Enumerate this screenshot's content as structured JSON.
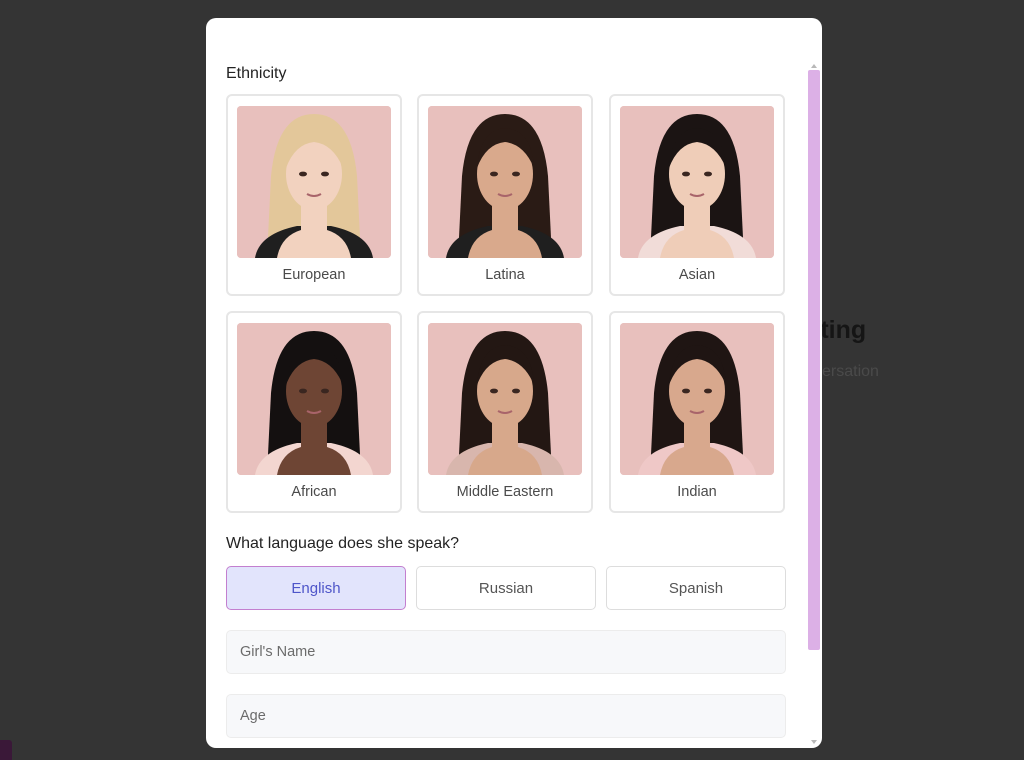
{
  "background": {
    "heading_fragment": "tting",
    "subtitle_fragment": "versation"
  },
  "modal": {
    "ethnicity_label": "Ethnicity",
    "ethnicities": [
      {
        "label": "European",
        "hair": "#e3c79a",
        "skin": "#f2d2bf",
        "top": "#1f1f1f"
      },
      {
        "label": "Latina",
        "hair": "#2a1b15",
        "skin": "#d9a98c",
        "top": "#1f1f1f"
      },
      {
        "label": "Asian",
        "hair": "#1b1413",
        "skin": "#efcdb8",
        "top": "#f1dcd8"
      },
      {
        "label": "African",
        "hair": "#141010",
        "skin": "#6e4534",
        "top": "#f3d6d0"
      },
      {
        "label": "Middle Eastern",
        "hair": "#231713",
        "skin": "#d7a88b",
        "top": "#d8b6ad"
      },
      {
        "label": "Indian",
        "hair": "#1f1513",
        "skin": "#d8a88d",
        "top": "#efc8c7"
      }
    ],
    "language_label": "What language does she speak?",
    "languages": [
      {
        "label": "English",
        "selected": true
      },
      {
        "label": "Russian",
        "selected": false
      },
      {
        "label": "Spanish",
        "selected": false
      }
    ],
    "name_field": {
      "placeholder": "Girl's Name",
      "value": ""
    },
    "age_field": {
      "placeholder": "Age",
      "value": ""
    }
  },
  "colors": {
    "overlay": "#343434",
    "scrollbar": "#dcb0e6",
    "accent_text": "#4e55c9",
    "accent_bg": "#e2e4fc",
    "accent_border": "#c37fcf",
    "photo_bg": "#e8c0bd"
  }
}
